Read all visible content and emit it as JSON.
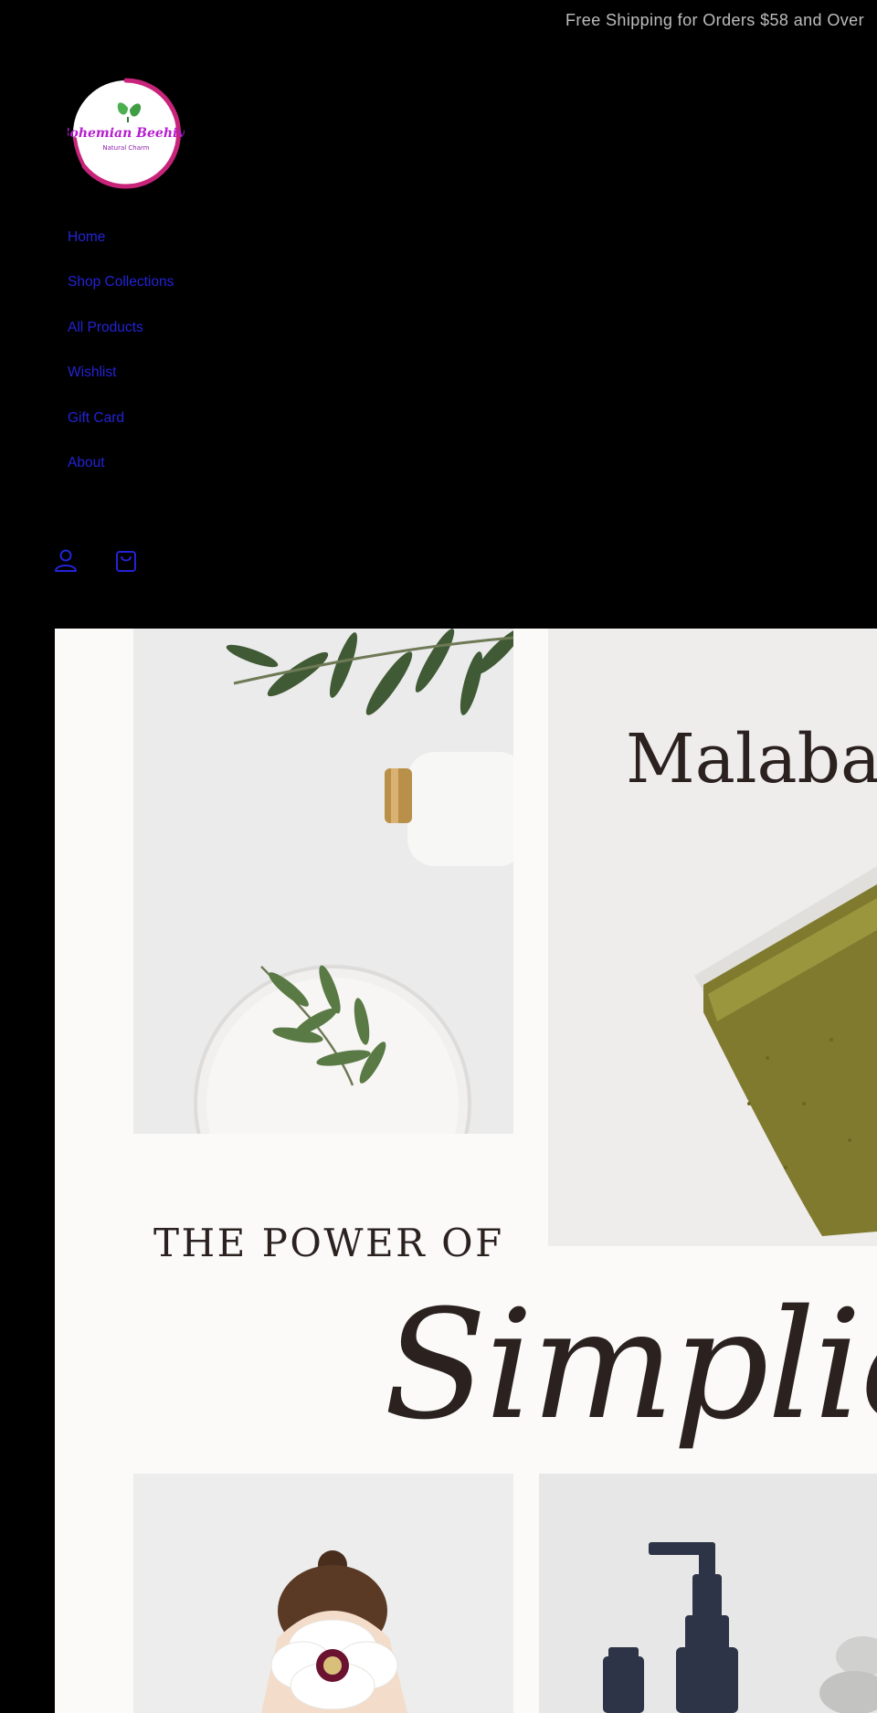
{
  "announcement": {
    "text": "Free Shipping for Orders $58 and Over"
  },
  "logo": {
    "name": "Bohemian Beehive",
    "tagline": "Natural Charm",
    "accent": "#c8247a",
    "text_color": "#b61ed0",
    "leaf_color": "#4caf50"
  },
  "nav": {
    "items": [
      {
        "label": "Home"
      },
      {
        "label": "Shop Collections"
      },
      {
        "label": "All Products"
      },
      {
        "label": "Wishlist"
      },
      {
        "label": "Gift Card"
      },
      {
        "label": "About"
      }
    ],
    "link_color": "#2323d6"
  },
  "header_icons": {
    "account": "account-icon",
    "cart": "cart-icon"
  },
  "hero": {
    "product_name": "Malabar",
    "title": "THE POWER OF",
    "script": "Simplicity"
  }
}
